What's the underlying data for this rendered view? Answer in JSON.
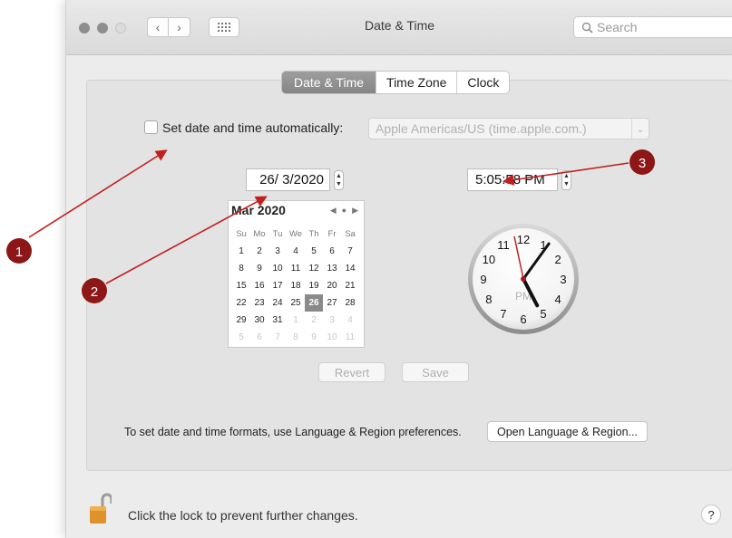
{
  "window": {
    "title": "Date & Time"
  },
  "toolbar": {
    "back_icon": "‹",
    "forward_icon": "›",
    "search_placeholder": "Search"
  },
  "tabs": [
    {
      "label": "Date & Time",
      "selected": true
    },
    {
      "label": "Time Zone",
      "selected": false
    },
    {
      "label": "Clock",
      "selected": false
    }
  ],
  "auto": {
    "label": "Set date and time automatically:",
    "checked": false,
    "server": "Apple Americas/US (time.apple.com.)"
  },
  "date_field": {
    "value": "26/ 3/2020"
  },
  "time_field": {
    "value": "5:05:58 PM"
  },
  "calendar": {
    "month_label": "Mar 2020",
    "weekdays": [
      "Su",
      "Mo",
      "Tu",
      "We",
      "Th",
      "Fr",
      "Sa"
    ],
    "days": [
      {
        "d": "1"
      },
      {
        "d": "2"
      },
      {
        "d": "3"
      },
      {
        "d": "4"
      },
      {
        "d": "5"
      },
      {
        "d": "6"
      },
      {
        "d": "7"
      },
      {
        "d": "8"
      },
      {
        "d": "9"
      },
      {
        "d": "10"
      },
      {
        "d": "11"
      },
      {
        "d": "12"
      },
      {
        "d": "13"
      },
      {
        "d": "14"
      },
      {
        "d": "15"
      },
      {
        "d": "16"
      },
      {
        "d": "17"
      },
      {
        "d": "18"
      },
      {
        "d": "19"
      },
      {
        "d": "20"
      },
      {
        "d": "21"
      },
      {
        "d": "22"
      },
      {
        "d": "23"
      },
      {
        "d": "24"
      },
      {
        "d": "25"
      },
      {
        "d": "26",
        "selected": true
      },
      {
        "d": "27"
      },
      {
        "d": "28"
      },
      {
        "d": "29"
      },
      {
        "d": "30"
      },
      {
        "d": "31"
      },
      {
        "d": "1",
        "dim": true
      },
      {
        "d": "2",
        "dim": true
      },
      {
        "d": "3",
        "dim": true
      },
      {
        "d": "4",
        "dim": true
      },
      {
        "d": "5",
        "dim": true
      },
      {
        "d": "6",
        "dim": true
      },
      {
        "d": "7",
        "dim": true
      },
      {
        "d": "8",
        "dim": true
      },
      {
        "d": "9",
        "dim": true
      },
      {
        "d": "10",
        "dim": true
      },
      {
        "d": "11",
        "dim": true
      }
    ]
  },
  "clock": {
    "numbers": [
      "12",
      "1",
      "2",
      "3",
      "4",
      "5",
      "6",
      "7",
      "8",
      "9",
      "10",
      "11"
    ],
    "period": "PM",
    "hours": 5,
    "minutes": 5,
    "seconds": 58
  },
  "buttons": {
    "revert": "Revert",
    "save": "Save"
  },
  "footer": {
    "formats_text": "To set date and time formats, use Language & Region preferences.",
    "language_button": "Open Language & Region...",
    "lock_text": "Click the lock to prevent further changes.",
    "help": "?"
  },
  "annotations": [
    {
      "label": "1"
    },
    {
      "label": "2"
    },
    {
      "label": "3"
    }
  ],
  "colors": {
    "annotation_red": "#c21f1f",
    "marker_dark_red": "#8d1717",
    "selected_tab": "#8f8f8f"
  }
}
